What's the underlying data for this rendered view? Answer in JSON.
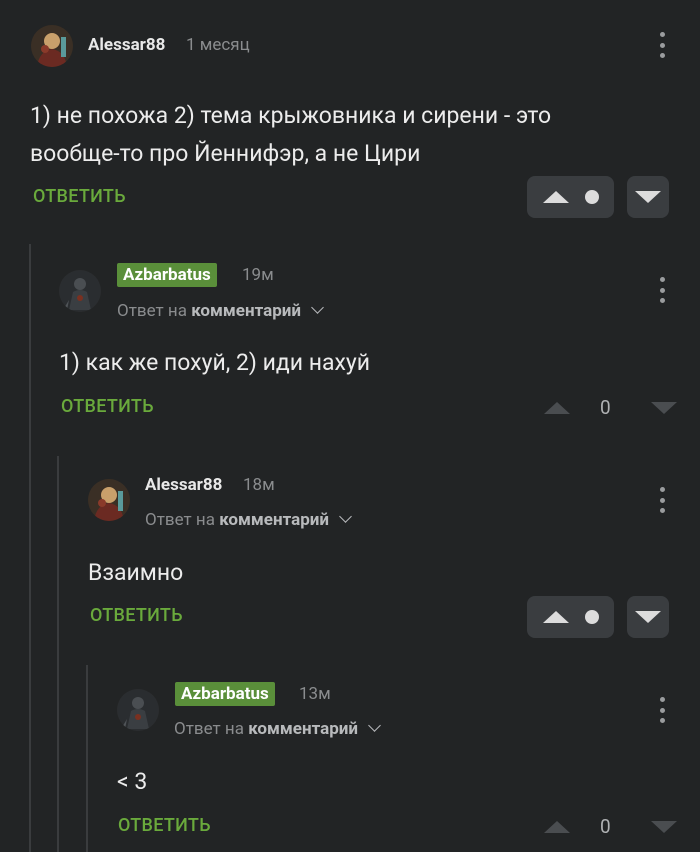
{
  "comments": [
    {
      "author": "Alessar88",
      "time": "1 месяц",
      "text_lines": [
        "1) не похожа 2) тема крыжовника и сирени - это",
        "вообще-то про Йеннифэр, а не Цири"
      ],
      "reply_label": "ОТВЕТИТЬ"
    },
    {
      "author": "Azbarbatus",
      "time": "19м",
      "reply_to_prefix": "Ответ на",
      "reply_to_link": "комментарий",
      "text_lines": [
        "1) как же похуй, 2) иди нахуй"
      ],
      "reply_label": "ОТВЕТИТЬ",
      "score": "0"
    },
    {
      "author": "Alessar88",
      "time": "18м",
      "reply_to_prefix": "Ответ на",
      "reply_to_link": "комментарий",
      "text_lines": [
        "Взаимно"
      ],
      "reply_label": "ОТВЕТИТЬ"
    },
    {
      "author": "Azbarbatus",
      "time": "13м",
      "reply_to_prefix": "Ответ на",
      "reply_to_link": "комментарий",
      "text_lines": [
        "< 3"
      ],
      "reply_label": "ОТВЕТИТЬ",
      "score": "0"
    }
  ],
  "colors": {
    "background": "#222425",
    "accent_green": "#6aaa3c",
    "badge_green": "#5a8f3a",
    "vote_box": "#3a3d40"
  },
  "icons": {
    "more": "more-vertical-icon",
    "upvote": "arrow-up-icon",
    "downvote": "arrow-down-icon",
    "chevron": "chevron-down-icon"
  }
}
